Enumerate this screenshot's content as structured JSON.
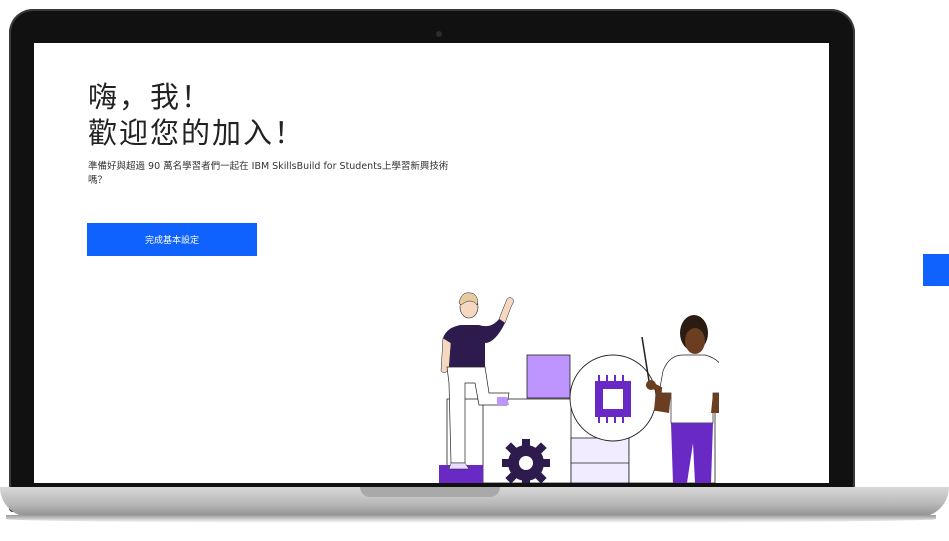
{
  "welcome": {
    "title_line1": "嗨，我！",
    "title_line2": "歡迎您的加入！",
    "description": "準備好與超過 90 萬名學習者們一起在 IBM SkillsBuild for Students上學習新興技術嗎？",
    "cta_label": "完成基本設定"
  },
  "colors": {
    "accent": "#0f62fe",
    "purple_dark": "#2d1b4e",
    "purple": "#6929c4",
    "purple_light": "#be95ff"
  }
}
